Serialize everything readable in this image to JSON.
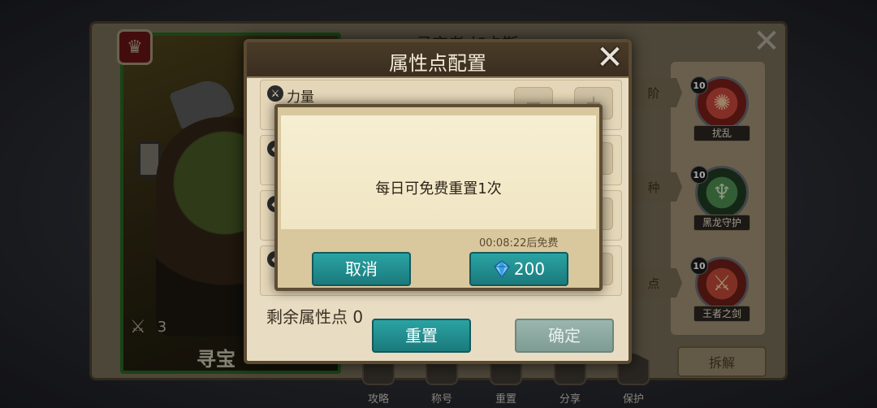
{
  "character": {
    "badge_icon": "lion-crest-icon",
    "name": "寻宝",
    "level": "3",
    "title_partial": "寻宝者 加卡斯"
  },
  "skills": [
    {
      "level": "10",
      "name": "扰乱",
      "icon": "disrupt-icon",
      "color": "#b8332b"
    },
    {
      "level": "10",
      "name": "黑龙守护",
      "icon": "black-dragon-guard-icon",
      "color": "#2f6b3a"
    },
    {
      "level": "10",
      "name": "王者之剑",
      "icon": "kings-sword-icon",
      "color": "#b03a2e"
    }
  ],
  "side_buttons": [
    "阶",
    "种",
    "点"
  ],
  "dismantle_label": "拆解",
  "bottom_nav": [
    {
      "label": "攻略"
    },
    {
      "label": "称号"
    },
    {
      "label": "重置"
    },
    {
      "label": "分享"
    },
    {
      "label": "保护"
    }
  ],
  "attr_dialog": {
    "title": "属性点配置",
    "rows": [
      {
        "name": "力量"
      },
      {
        "name": ""
      },
      {
        "name": ""
      },
      {
        "name": ""
      }
    ],
    "remaining_label": "剩余属性点 0",
    "reset_label": "重置",
    "confirm_label": "确定"
  },
  "popup": {
    "message": "每日可免费重置1次",
    "timer": "00:08:22后免费",
    "cancel_label": "取消",
    "pay_amount": "200"
  },
  "colors": {
    "button_teal": "#1f8f91",
    "card_border_green": "#3fa035"
  }
}
